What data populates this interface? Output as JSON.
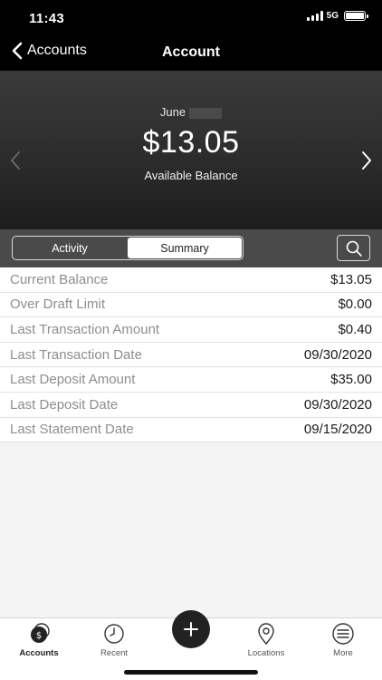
{
  "status": {
    "time": "11:43",
    "network": "5G"
  },
  "nav": {
    "back_label": "Accounts",
    "title": "Account"
  },
  "hero": {
    "month": "June",
    "balance": "$13.05",
    "balance_label": "Available Balance"
  },
  "tabs": [
    {
      "label": "Activity",
      "active": false
    },
    {
      "label": "Summary",
      "active": true
    }
  ],
  "summary": [
    {
      "label": "Current Balance",
      "value": "$13.05"
    },
    {
      "label": "Over Draft Limit",
      "value": "$0.00"
    },
    {
      "label": "Last Transaction Amount",
      "value": "$0.40"
    },
    {
      "label": "Last Transaction Date",
      "value": "09/30/2020"
    },
    {
      "label": "Last Deposit Amount",
      "value": "$35.00"
    },
    {
      "label": "Last Deposit Date",
      "value": "09/30/2020"
    },
    {
      "label": "Last Statement Date",
      "value": "09/15/2020"
    }
  ],
  "bottom_nav": [
    {
      "label": "Accounts",
      "icon": "dollar-icon",
      "active": true
    },
    {
      "label": "Recent",
      "icon": "clock-icon",
      "active": false
    },
    {
      "label": "Locations",
      "icon": "location-pin-icon",
      "active": false
    },
    {
      "label": "More",
      "icon": "menu-icon",
      "active": false
    }
  ],
  "add_button": {
    "icon": "plus-icon"
  }
}
